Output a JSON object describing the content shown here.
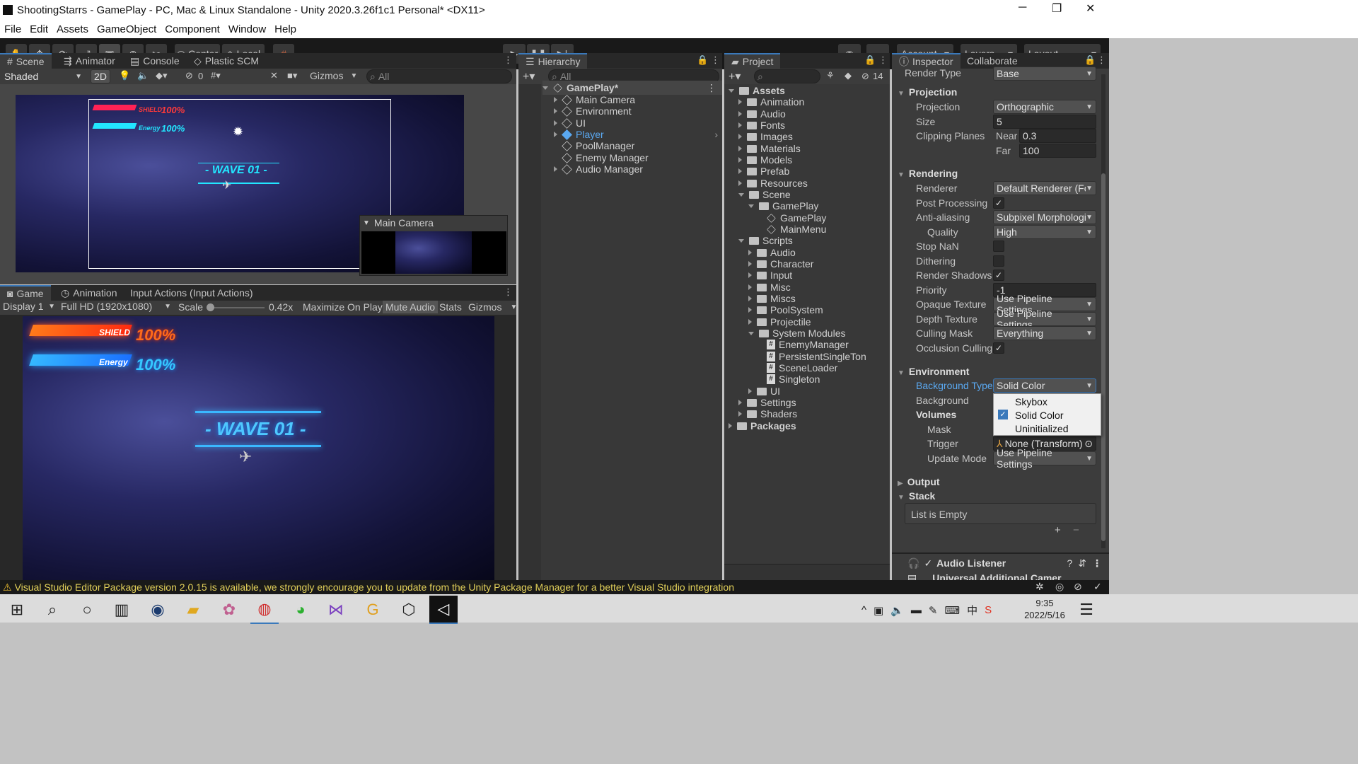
{
  "window": {
    "title": "ShootingStarrs - GamePlay - PC, Mac & Linux Standalone - Unity 2020.3.26f1c1 Personal* <DX11>",
    "minimize": "─",
    "restore": "❐",
    "close": "✕"
  },
  "menu": [
    "File",
    "Edit",
    "Assets",
    "GameObject",
    "Component",
    "Window",
    "Help"
  ],
  "toolbar": {
    "pivot": "Center",
    "space": "Local",
    "account": "Account",
    "layers": "Layers",
    "layout": "Layout"
  },
  "scene_tabs": [
    "Scene",
    "Animator",
    "Console",
    "Plastic SCM"
  ],
  "scene_bar": {
    "shading": "Shaded",
    "mode2d": "2D",
    "hidden_count": "0",
    "gizmos": "Gizmos",
    "search_placeholder": "All"
  },
  "hud": {
    "shield_label": "SHIELD",
    "shield_value": "100%",
    "energy_label": "Energy",
    "energy_value": "100%",
    "wave": "- WAVE 01 -"
  },
  "camera_preview": {
    "title": "Main Camera"
  },
  "game_tabs": [
    "Game",
    "Animation",
    "Input Actions (Input Actions)"
  ],
  "game_bar": {
    "display": "Display 1",
    "resolution": "Full HD (1920x1080)",
    "scale_label": "Scale",
    "scale_value": "0.42x",
    "scale_fraction": 0.42,
    "maximize": "Maximize On Play",
    "mute": "Mute Audio",
    "stats": "Stats",
    "gizmos": "Gizmos"
  },
  "hierarchy": {
    "title": "Hierarchy",
    "search_placeholder": "All",
    "scene": "GamePlay*",
    "items": [
      "Main Camera",
      "Environment",
      "UI",
      "Player",
      "PoolManager",
      "Enemy Manager",
      "Audio Manager"
    ]
  },
  "project": {
    "title": "Project",
    "hidden_count": "14",
    "root": "Assets",
    "folders": [
      "Animation",
      "Audio",
      "Fonts",
      "Images",
      "Materials",
      "Models",
      "Prefab",
      "Resources",
      "Scene"
    ],
    "scene_sub": "GamePlay",
    "scene_files": [
      "GamePlay",
      "MainMenu"
    ],
    "scripts": "Scripts",
    "script_folders": [
      "Audio",
      "Character",
      "Input",
      "Misc",
      "Miscs",
      "PoolSystem",
      "Projectile",
      "System Modules"
    ],
    "system_scripts": [
      "EnemyManager",
      "PersistentSingleTon",
      "SceneLoader",
      "Singleton"
    ],
    "after": [
      "UI",
      "Settings",
      "Shaders"
    ],
    "packages": "Packages"
  },
  "inspector": {
    "tabs": [
      "Inspector",
      "Collaborate"
    ],
    "render_type_label": "Render Type",
    "render_type": "Base",
    "projection_header": "Projection",
    "projection_label": "Projection",
    "projection": "Orthographic",
    "size_label": "Size",
    "size": "5",
    "clipping_label": "Clipping Planes",
    "near_label": "Near",
    "near": "0.3",
    "far_label": "Far",
    "far": "100",
    "rendering_header": "Rendering",
    "renderer_label": "Renderer",
    "renderer": "Default Renderer (For",
    "postproc_label": "Post Processing",
    "aa_label": "Anti-aliasing",
    "aa": "Subpixel Morphologic",
    "quality_label": "Quality",
    "quality": "High",
    "stopnan_label": "Stop NaN",
    "dither_label": "Dithering",
    "shadows_label": "Render Shadows",
    "priority_label": "Priority",
    "priority": "-1",
    "opaque_label": "Opaque Texture",
    "opaque": "Use Pipeline Settings",
    "depth_label": "Depth Texture",
    "depth": "Use Pipeline Settings",
    "culling_label": "Culling Mask",
    "culling": "Everything",
    "occlusion_label": "Occlusion Culling",
    "env_header": "Environment",
    "bgtype_label": "Background Type",
    "bgtype": "Solid Color",
    "bg_label": "Background",
    "volumes_label": "Volumes",
    "mask_label": "Mask",
    "trigger_label": "Trigger",
    "trigger": "None (Transform)",
    "update_label": "Update Mode",
    "update": "Use Pipeline Settings",
    "output_header": "Output",
    "stack_header": "Stack",
    "stack_empty": "List is Empty",
    "dropdown_options": [
      "Skybox",
      "Solid Color",
      "Uninitialized"
    ],
    "audio_listener": "Audio Listener",
    "additional": "Universal Additional Camer"
  },
  "status": "Visual Studio Editor Package version 2.0.15 is available, we strongly encourage you to update from the Unity Package Manager for a better Visual Studio integration",
  "taskbar": {
    "time": "9:35",
    "date": "2022/5/16"
  }
}
